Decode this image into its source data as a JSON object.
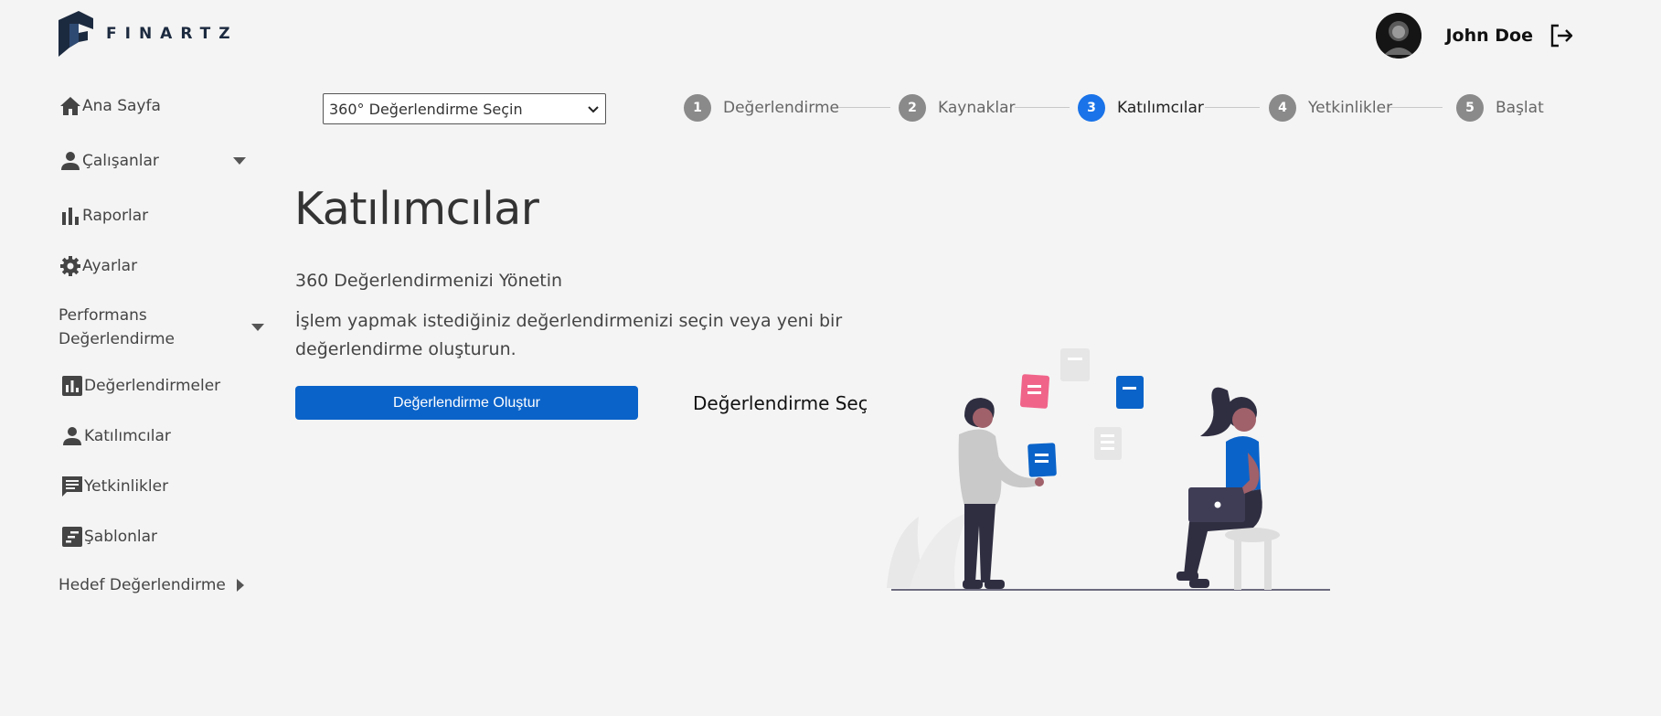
{
  "brand": {
    "logo_text": "FINARTZ"
  },
  "user": {
    "name": "John Doe"
  },
  "sidebar": {
    "items": [
      {
        "label": "Ana Sayfa",
        "icon": "home-icon"
      },
      {
        "label": "Çalışanlar",
        "icon": "person-icon",
        "expandable": true
      },
      {
        "label": "Raporlar",
        "icon": "bar-chart-icon"
      },
      {
        "label": "Ayarlar",
        "icon": "gear-icon"
      },
      {
        "label": "Performans Değerlendirme",
        "expandable": true,
        "expanded": true
      },
      {
        "label": "Değerlendirmeler",
        "icon": "chart-box-icon"
      },
      {
        "label": "Katılımcılar",
        "icon": "person-icon"
      },
      {
        "label": "Yetkinlikler",
        "icon": "comment-icon"
      },
      {
        "label": "Şablonlar",
        "icon": "template-icon"
      },
      {
        "label": "Hedef Değerlendirme",
        "expandable": true,
        "expanded": false
      }
    ]
  },
  "evaluation_select": {
    "value": "360° Değerlendirme Seçin"
  },
  "stepper": {
    "active_step": 3,
    "steps": [
      {
        "number": "1",
        "label": "Değerlendirme"
      },
      {
        "number": "2",
        "label": "Kaynaklar"
      },
      {
        "number": "3",
        "label": "Katılımcılar"
      },
      {
        "number": "4",
        "label": "Yetkinlikler"
      },
      {
        "number": "5",
        "label": "Başlat"
      }
    ]
  },
  "main": {
    "title": "Katılımcılar",
    "subtitle": "360 Değerlendirmenizi Yönetin",
    "description": "İşlem yapmak istediğiniz değerlendirmenizi seçin veya yeni bir değerlendirme oluşturun.",
    "create_button": "Değerlendirme Oluştur",
    "select_button": "Değerlendirme Seç"
  },
  "colors": {
    "accent": "#0a63c9",
    "active_step": "#1a73e8",
    "inactive_step": "#8a8a8a",
    "background": "#f4f4f4",
    "illustration_pink": "#f0648a",
    "illustration_blue": "#0a63c9"
  }
}
